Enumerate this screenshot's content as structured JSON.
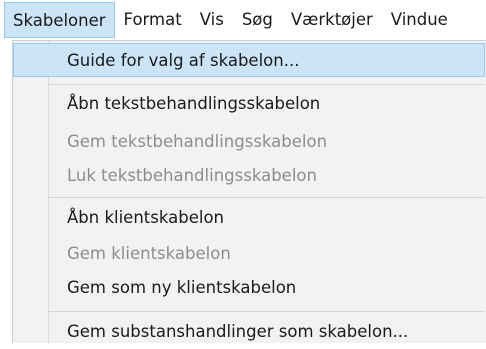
{
  "menubar": {
    "items": [
      {
        "label": "Skabeloner",
        "active": true
      },
      {
        "label": "Format"
      },
      {
        "label": "Vis"
      },
      {
        "label": "Søg"
      },
      {
        "label": "Værktøjer"
      },
      {
        "label": "Vindue"
      }
    ]
  },
  "menu": {
    "items": [
      {
        "label": "Guide for valg af skabelon...",
        "enabled": true,
        "highlighted": true
      },
      {
        "label": "Åbn tekstbehandlingsskabelon",
        "enabled": true
      },
      {
        "label": "Gem tekstbehandlingsskabelon",
        "enabled": false
      },
      {
        "label": "Luk tekstbehandlingsskabelon",
        "enabled": false
      },
      {
        "label": "Åbn klientskabelon",
        "enabled": true
      },
      {
        "label": "Gem klientskabelon",
        "enabled": false
      },
      {
        "label": "Gem som ny klientskabelon",
        "enabled": true
      },
      {
        "label": "Gem substanshandlinger som skabelon...",
        "enabled": true
      }
    ]
  },
  "colors": {
    "highlight_bg": "#cce4f7",
    "highlight_border": "#99c9ef",
    "menu_bg": "#f2f2f2",
    "disabled_text": "#8d8d8d"
  }
}
